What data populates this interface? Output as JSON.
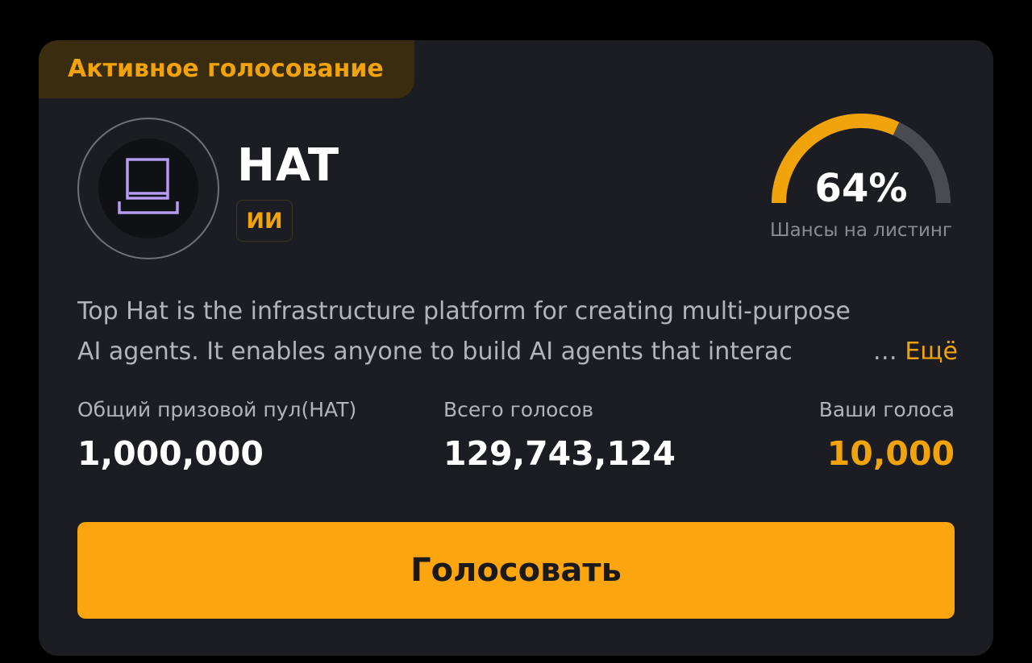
{
  "card": {
    "badge": "Активное голосование",
    "token": {
      "name": "HAT",
      "tag": "ИИ",
      "logo_icon": "laptop-icon",
      "logo_color": "#b49cf2"
    },
    "gauge": {
      "value_text": "64%",
      "value": 0.64,
      "label": "Шансы на листинг",
      "fill_color": "#f0a30a",
      "track_color": "#4a4b50"
    },
    "description": {
      "line1": "Top Hat is the infrastructure platform for creating multi-purpose",
      "line2": "AI agents. It enables anyone to build AI agents that interac",
      "ellipsis": "…",
      "more": "Ещё"
    },
    "stats": [
      {
        "label": "Общий призовой пул(HAT)",
        "value": "1,000,000"
      },
      {
        "label": "Всего голосов",
        "value": "129,743,124"
      },
      {
        "label": "Ваши голоса",
        "value": "10,000"
      }
    ],
    "vote_button": "Голосовать",
    "accent": "#f0a30a",
    "button_color": "#fca50f"
  }
}
